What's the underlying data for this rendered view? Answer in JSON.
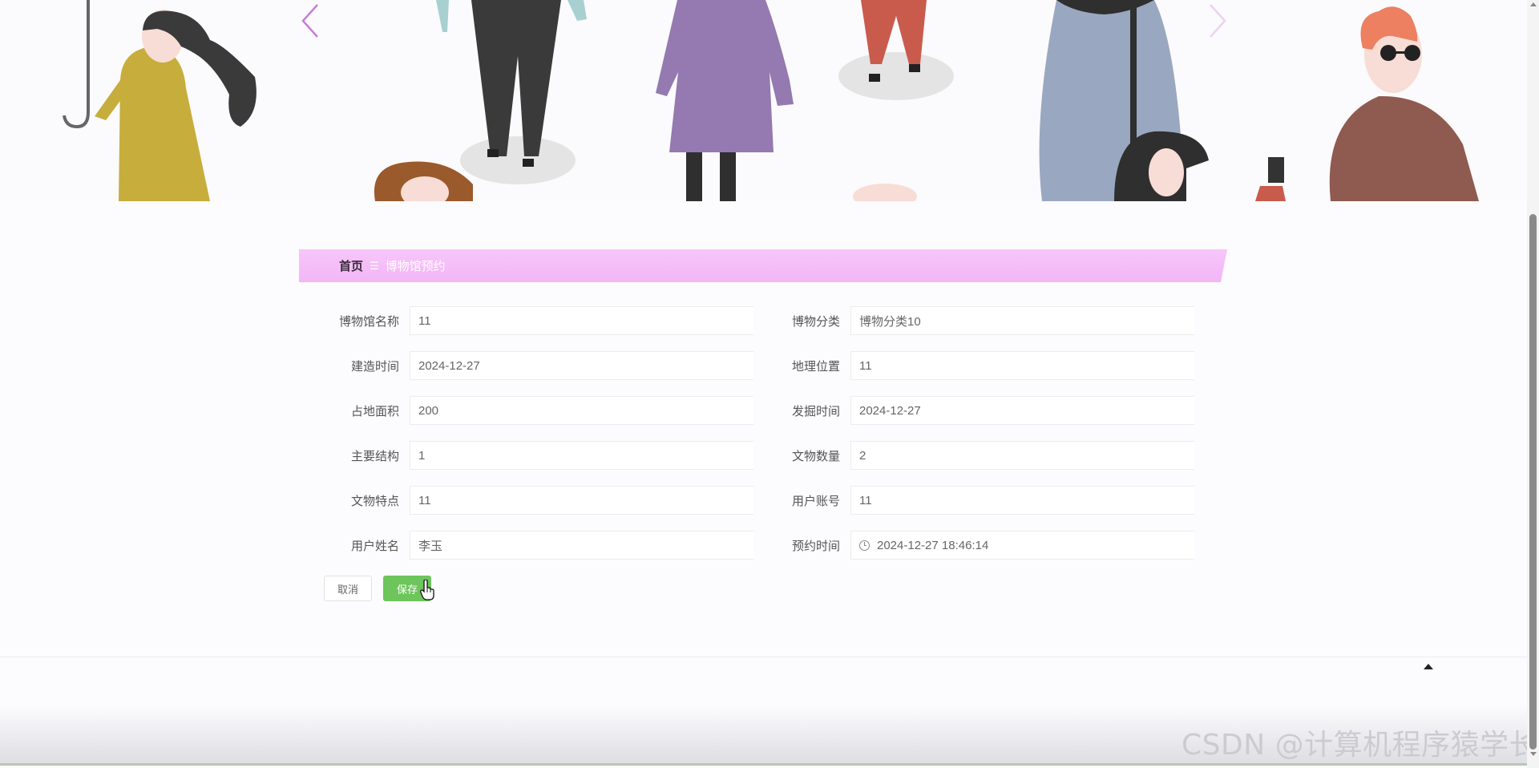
{
  "breadcrumb": {
    "home": "首页",
    "separator": "☰",
    "current": "博物馆预约"
  },
  "form": {
    "rows": [
      {
        "left": {
          "label": "博物馆名称",
          "value": "11"
        },
        "right": {
          "label": "博物分类",
          "value": "博物分类10"
        }
      },
      {
        "left": {
          "label": "建造时间",
          "value": "2024-12-27"
        },
        "right": {
          "label": "地理位置",
          "value": "11"
        }
      },
      {
        "left": {
          "label": "占地面积",
          "value": "200"
        },
        "right": {
          "label": "发掘时间",
          "value": "2024-12-27"
        }
      },
      {
        "left": {
          "label": "主要结构",
          "value": "1"
        },
        "right": {
          "label": "文物数量",
          "value": "2"
        }
      },
      {
        "left": {
          "label": "文物特点",
          "value": "11"
        },
        "right": {
          "label": "用户账号",
          "value": "11"
        }
      },
      {
        "left": {
          "label": "用户姓名",
          "value": "李玉"
        },
        "right": {
          "label": "预约时间",
          "value": "2024-12-27 18:46:14",
          "icon": "clock-icon"
        }
      }
    ]
  },
  "actions": {
    "cancel_label": "取消",
    "save_label": "保存"
  },
  "watermark": "CSDN @计算机程序猿学长",
  "colors": {
    "breadcrumb_bar": "#f5bdf8",
    "save_button": "#6dc55b",
    "carousel_arrow": "#c77ddb"
  },
  "icons": {
    "carousel_prev": "chevron-left-icon",
    "carousel_next": "chevron-right-icon",
    "back_to_top": "caret-up-icon"
  }
}
